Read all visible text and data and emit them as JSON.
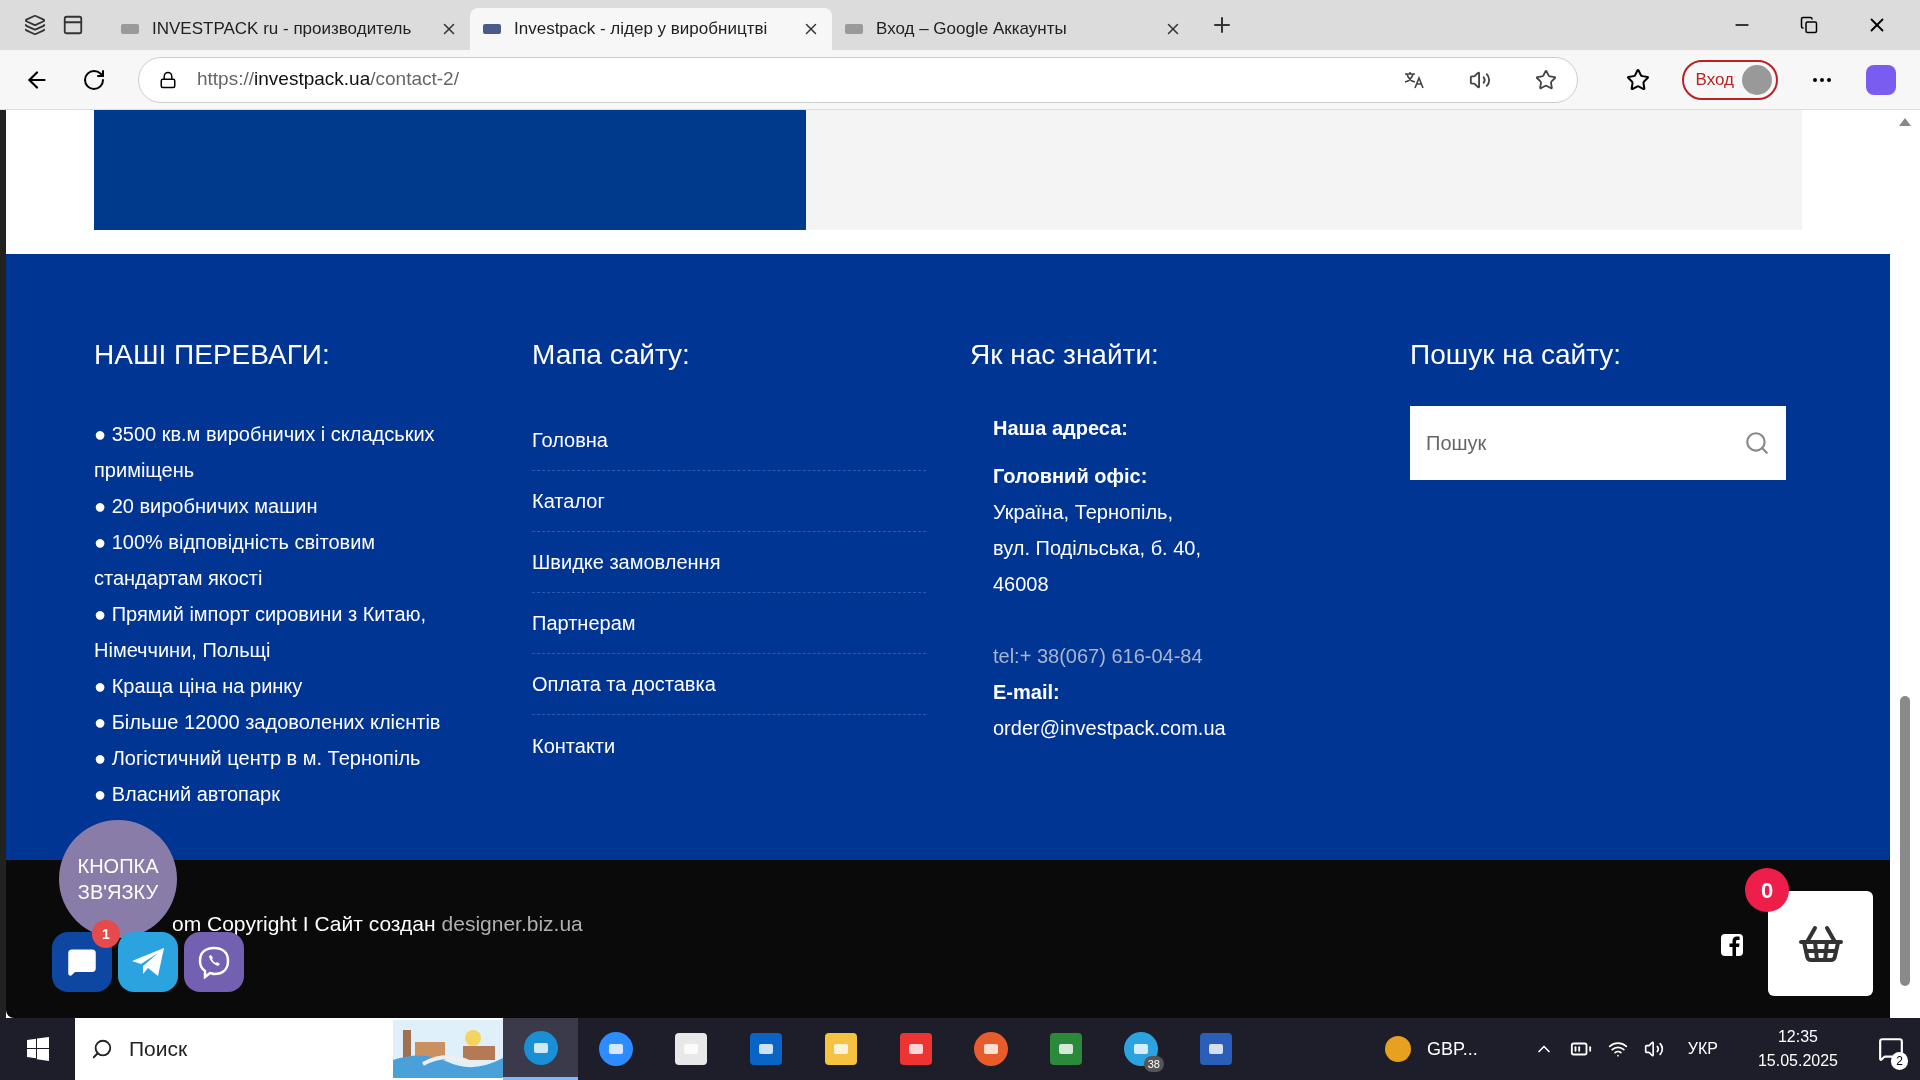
{
  "browser": {
    "tabs": [
      {
        "title": "INVESTPACK ru - производитель",
        "selected": false
      },
      {
        "title": "Investpack - лідер у виробництві",
        "selected": true
      },
      {
        "title": "Вход – Google Аккаунты",
        "selected": false
      }
    ],
    "url": {
      "scheme": "https://",
      "host": "investpack.ua",
      "path": "/contact-2/"
    },
    "profile_button": "Вход"
  },
  "footer": {
    "advantages": {
      "title": "НАШІ ПЕРЕВАГИ:",
      "items": [
        "● 3500 кв.м виробничих і складських приміщень",
        "● 20 виробничих машин",
        "● 100% відповідність світовим стандартам якості",
        "● Прямий імпорт сировини з Китаю, Німеччини, Польщі",
        "● Краща ціна на ринку",
        "● Більше 12000 задоволених клієнтів",
        "● Логістичний центр в м. Тернопіль",
        "● Власний автопарк"
      ]
    },
    "sitemap": {
      "title": "Мапа сайту:",
      "links": [
        "Головна",
        "Каталог",
        "Швидке замовлення",
        "Партнерам",
        "Оплата та доставка",
        "Контакти"
      ]
    },
    "contacts": {
      "title": "Як нас знайти:",
      "address_label": "Наша адреса:",
      "office_label": "Головний офіс:",
      "address_lines": [
        "Україна, Тернопіль,",
        "вул. Подільська, б. 40,",
        "46008"
      ],
      "phone": "tel:+ 38(067) 616-04-84",
      "email_label": "E-mail:",
      "email": "order@investpack.com.ua"
    },
    "search": {
      "title": "Пошук на сайту:",
      "placeholder": "Пошук"
    }
  },
  "bottom_bar": {
    "copyright": "om Copyright I Сайт создан",
    "designer_link": "designer.biz.ua"
  },
  "contact_widget": {
    "label": "КНОПКА ЗВ'ЯЗКУ",
    "chat_badge": "1"
  },
  "cart": {
    "count": "0"
  },
  "taskbar": {
    "search_placeholder": "Поиск",
    "apps": [
      {
        "kind": "edge",
        "active": true
      },
      {
        "kind": "zoom",
        "active": false
      },
      {
        "kind": "store",
        "active": false
      },
      {
        "kind": "outlook",
        "active": false
      },
      {
        "kind": "explorer",
        "active": false
      },
      {
        "kind": "gift",
        "active": false
      },
      {
        "kind": "browser",
        "active": false
      },
      {
        "kind": "greenapp",
        "active": false
      },
      {
        "kind": "telegram",
        "active": false,
        "badge": "38"
      },
      {
        "kind": "word",
        "active": false
      }
    ],
    "currency": "GBP...",
    "language": "УКР",
    "time": "12:35",
    "date": "15.05.2025",
    "notifications": "2"
  }
}
